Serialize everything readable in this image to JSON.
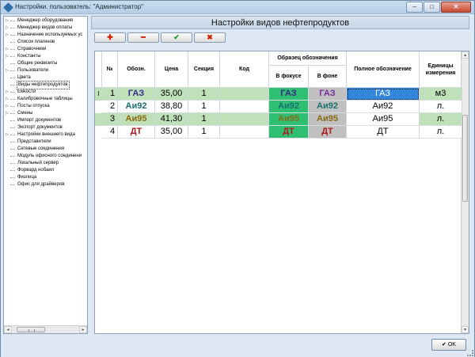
{
  "window": {
    "title": "Настройки. пользователь: \"Администратор\"",
    "min_label": "–",
    "max_label": "□",
    "close_label": "✕"
  },
  "tree": {
    "items": [
      {
        "label": "Менеджер оборудования",
        "expandable": true
      },
      {
        "label": "Менеджер видов оплаты",
        "expandable": true
      },
      {
        "label": "Назначение используемых ус",
        "expandable": true
      },
      {
        "label": "Список плагинов",
        "expandable": false
      },
      {
        "label": "Справочники",
        "expandable": true
      },
      {
        "label": "Константы",
        "expandable": true
      },
      {
        "label": "Общие реквизиты",
        "expandable": false
      },
      {
        "label": "Пользователи",
        "expandable": true
      },
      {
        "label": "Цвета",
        "expandable": false
      },
      {
        "label": "Виды нефтепродуктов",
        "expandable": false,
        "selected": true
      },
      {
        "label": "Емкости",
        "expandable": true
      },
      {
        "label": "Калибровочные таблицы",
        "expandable": true
      },
      {
        "label": "Посты отпуска",
        "expandable": true
      },
      {
        "label": "Смены",
        "expandable": true
      },
      {
        "label": "Импорт документов",
        "expandable": false
      },
      {
        "label": "Экспорт документов",
        "expandable": false
      },
      {
        "label": "Настройки внешнего вида",
        "expandable": true
      },
      {
        "label": "Представители",
        "expandable": false
      },
      {
        "label": "Сетевые соединения",
        "expandable": false
      },
      {
        "label": "Модуль офисного соединени",
        "expandable": false
      },
      {
        "label": "Локальный сервер",
        "expandable": false
      },
      {
        "label": "Форвард нобаил",
        "expandable": false
      },
      {
        "label": "Физлица",
        "expandable": false
      },
      {
        "label": "Офис для драйверов",
        "expandable": false
      }
    ],
    "scroll_left": "◂",
    "scroll_right": "▸"
  },
  "panel": {
    "title": "Настройки видов нефтепродуктов"
  },
  "toolbar": {
    "add": "✚",
    "remove": "━",
    "apply": "✔",
    "cancel": "✖"
  },
  "table": {
    "headers": {
      "no": "№",
      "code": "Обозн.",
      "price": "Цена",
      "section": "Секция",
      "kod": "Код",
      "sample": "Образец обозначения",
      "focus": "В фокусе",
      "background": "В фоне",
      "full": "Полное обозначение",
      "units": "Единицы измерения"
    },
    "rows": [
      {
        "marker": "I",
        "no": "1",
        "code": "ГАЗ",
        "price": "35,00",
        "section": "1",
        "kod": "",
        "focus": "ГАЗ",
        "background": "ГАЗ",
        "full": "ГАЗ",
        "units": "м3",
        "row_bg": "#bfe0b9",
        "code_color": "#3a2a8c",
        "focus_bg": "#2fbf72",
        "focus_color": "#3a2a8c",
        "back_bg": "#c0c0c0",
        "back_color": "#7a2aa0",
        "full_bg": "#3388dd",
        "full_color": "#ffffff"
      },
      {
        "marker": "",
        "no": "2",
        "code": "Аи92",
        "price": "38,80",
        "section": "1",
        "kod": "",
        "focus": "Аи92",
        "background": "Аи92",
        "full": "Аи92",
        "units": "л.",
        "row_bg": "#ffffff",
        "code_color": "#1a7070",
        "focus_bg": "#2fbf72",
        "focus_color": "#1a7070",
        "back_bg": "#c0c0c0",
        "back_color": "#1a7070",
        "full_bg": "",
        "full_color": "#000000"
      },
      {
        "marker": "",
        "no": "3",
        "code": "Аи95",
        "price": "41,30",
        "section": "1",
        "kod": "",
        "focus": "Аи95",
        "background": "Аи95",
        "full": "Аи95",
        "units": "л.",
        "row_bg": "#bfe0b9",
        "code_color": "#8a6a10",
        "focus_bg": "#2fbf72",
        "focus_color": "#8a6a10",
        "back_bg": "#c0c0c0",
        "back_color": "#8a6a10",
        "full_bg": "",
        "full_color": "#000000"
      },
      {
        "marker": "",
        "no": "4",
        "code": "ДТ",
        "price": "35,00",
        "section": "1",
        "kod": "",
        "focus": "ДТ",
        "background": "ДТ",
        "full": "ДТ",
        "units": "л.",
        "row_bg": "#ffffff",
        "code_color": "#b01818",
        "focus_bg": "#2fbf72",
        "focus_color": "#b01818",
        "back_bg": "#c0c0c0",
        "back_color": "#b01818",
        "full_bg": "",
        "full_color": "#000000"
      }
    ]
  },
  "footer": {
    "ok_label": "✔ OK"
  },
  "colors": {
    "add": "#cc2200",
    "remove": "#cc2200",
    "apply": "#1a9a2a",
    "cancel": "#cc2200"
  }
}
